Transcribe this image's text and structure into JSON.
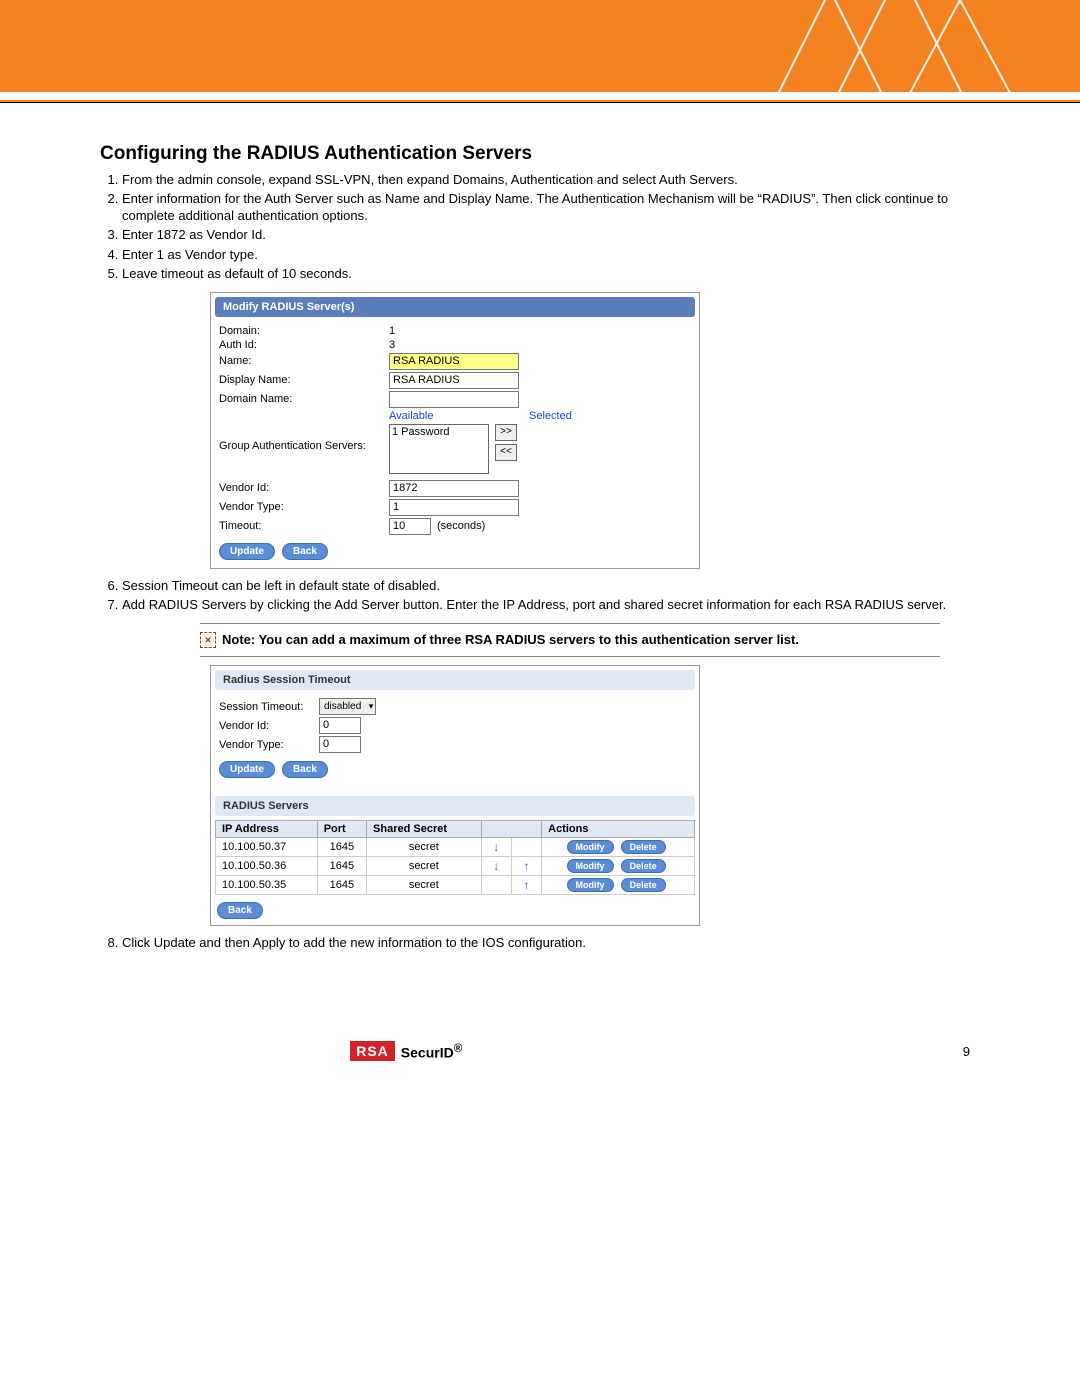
{
  "heading": "Configuring the RADIUS Authentication Servers",
  "steps_a": [
    "From the admin console, expand SSL-VPN, then expand Domains, Authentication and select Auth Servers.",
    "Enter information for the Auth Server such as Name and Display Name.  The Authentication Mechanism will be “RADIUS”.  Then click continue to complete additional authentication options.",
    "Enter 1872 as Vendor Id.",
    "Enter 1 as Vendor type.",
    "Leave timeout as default of 10 seconds."
  ],
  "panel1": {
    "title": "Modify RADIUS Server(s)",
    "domain_lab": "Domain:",
    "domain_val": "1",
    "authid_lab": "Auth Id:",
    "authid_val": "3",
    "name_lab": "Name:",
    "name_val": "RSA RADIUS",
    "disp_lab": "Display Name:",
    "disp_val": "RSA RADIUS",
    "dname_lab": "Domain Name:",
    "dname_val": "",
    "avail_hdr": "Available",
    "sel_hdr": "Selected",
    "gas_lab": "Group Authentication Servers:",
    "list_item": "1  Password",
    "vendorid_lab": "Vendor Id:",
    "vendorid_val": "1872",
    "vendortype_lab": "Vendor Type:",
    "vendortype_val": "1",
    "timeout_lab": "Timeout:",
    "timeout_val": "10",
    "timeout_suffix": "(seconds)",
    "btn_update": "Update",
    "btn_back": "Back"
  },
  "steps_b": [
    "Session Timeout can be left in default state of disabled.",
    "Add RADIUS Servers by clicking the Add Server button.  Enter the IP Address, port and shared secret information for each RSA RADIUS server."
  ],
  "note": "Note: You can add a maximum of three RSA RADIUS servers to this authentication server list.",
  "panel2": {
    "title1": "Radius Session Timeout",
    "st_lab": "Session Timeout:",
    "st_val": "disabled",
    "vendorid_lab": "Vendor Id:",
    "vendorid_val": "0",
    "vendortype_lab": "Vendor Type:",
    "vendortype_val": "0",
    "btn_update": "Update",
    "btn_back": "Back",
    "title2": "RADIUS Servers",
    "th_ip": "IP Address",
    "th_port": "Port",
    "th_secret": "Shared Secret",
    "th_actions": "Actions",
    "rows": [
      {
        "ip": "10.100.50.37",
        "port": "1645",
        "secret": "secret",
        "down": true,
        "up": false
      },
      {
        "ip": "10.100.50.36",
        "port": "1645",
        "secret": "secret",
        "down": true,
        "up": true
      },
      {
        "ip": "10.100.50.35",
        "port": "1645",
        "secret": "secret",
        "down": false,
        "up": true
      }
    ],
    "btn_modify": "Modify",
    "btn_delete": "Delete",
    "btn_back2": "Back"
  },
  "steps_c": [
    "Click Update and then Apply to add the new information to the IOS configuration."
  ],
  "footer": {
    "rsa": "RSA",
    "securid": "SecurID",
    "reg": "®",
    "page": "9"
  }
}
